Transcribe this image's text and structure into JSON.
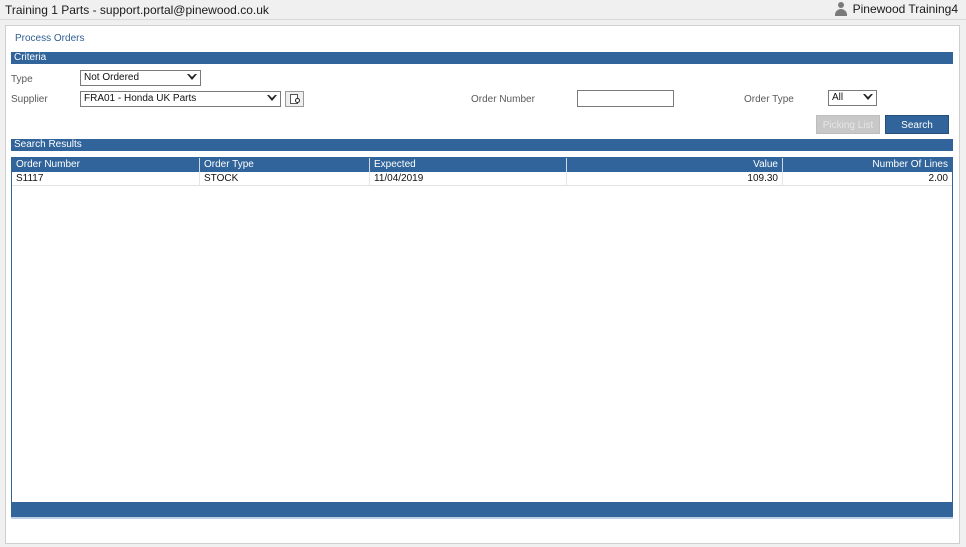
{
  "window": {
    "title": "Training 1 Parts - support.portal@pinewood.co.uk",
    "user": "Pinewood Training4",
    "user_icon": "user-icon"
  },
  "page": {
    "title": "Process Orders"
  },
  "criteria": {
    "header": "Criteria",
    "type_label": "Type",
    "type_value": "Not Ordered",
    "supplier_label": "Supplier",
    "supplier_value": "FRA01 - Honda UK Parts",
    "order_number_label": "Order Number",
    "order_number_value": "",
    "order_type_label": "Order Type",
    "order_type_value": "All",
    "picking_list_label": "Picking List",
    "search_label": "Search"
  },
  "results": {
    "header": "Search Results",
    "columns": [
      "Order Number",
      "Order Type",
      "Expected",
      "Value",
      "Number Of Lines"
    ],
    "rows": [
      {
        "order_number": "S1117",
        "order_type": "STOCK",
        "expected": "11/04/2019",
        "value": "109.30",
        "lines": "2.00"
      }
    ]
  },
  "colors": {
    "accent": "#30649a",
    "title_text": "#2f5f93"
  }
}
